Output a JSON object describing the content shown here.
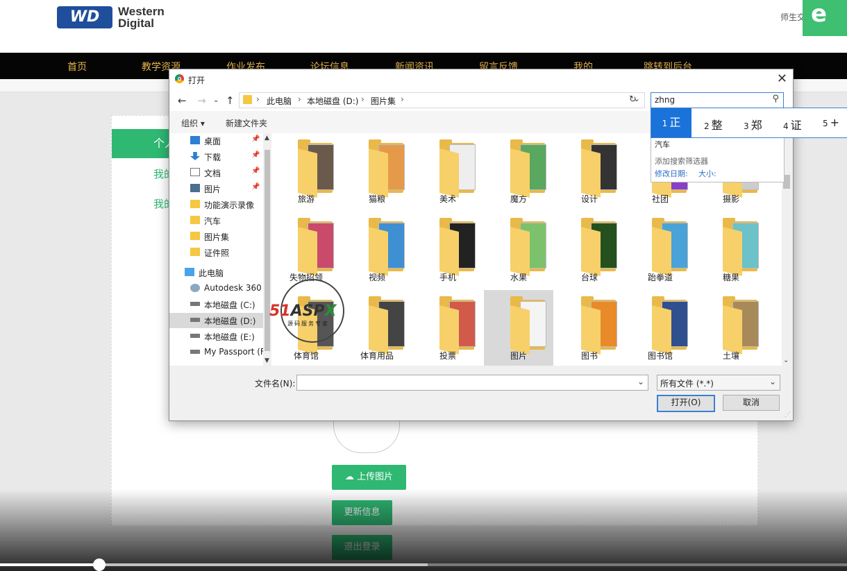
{
  "site": {
    "logo_badge": "WD",
    "logo_line1": "Western",
    "logo_line2": "Digital",
    "user_text": "师生交",
    "ie_badge": "e",
    "nav": [
      "首页",
      "教学资源",
      "作业发布",
      "论坛信息",
      "新闻资讯",
      "留言反馈",
      "我的",
      "跳转到后台"
    ],
    "left_menu_head": "个人",
    "left_links": [
      "我的",
      "我的"
    ],
    "upload_button": "上传图片",
    "update_button": "更新信息",
    "logout_button": "退出登录",
    "video_progress": 0.117,
    "video_buffered": 0.505
  },
  "dialog": {
    "title": "打开",
    "breadcrumb": [
      "此电脑",
      "本地磁盘 (D:)",
      "图片集"
    ],
    "search_value": "zhng",
    "toolbar": {
      "organize": "组织 ▾",
      "new_folder": "新建文件夹"
    },
    "sidebar": [
      {
        "label": "桌面",
        "icon": "desktop-icon",
        "pinned": true
      },
      {
        "label": "下载",
        "icon": "download-icon",
        "pinned": true
      },
      {
        "label": "文档",
        "icon": "document-icon",
        "pinned": true
      },
      {
        "label": "图片",
        "icon": "pictures-icon",
        "pinned": true
      },
      {
        "label": "功能演示录像",
        "icon": "folder-icon",
        "pinned": false
      },
      {
        "label": "汽车",
        "icon": "folder-icon",
        "pinned": false
      },
      {
        "label": "图片集",
        "icon": "folder-icon",
        "pinned": false
      },
      {
        "label": "证件照",
        "icon": "folder-icon",
        "pinned": false
      },
      {
        "label": "此电脑",
        "icon": "computer-icon",
        "pinned": false
      },
      {
        "label": "Autodesk 360",
        "icon": "cloud-icon",
        "pinned": false
      },
      {
        "label": "本地磁盘 (C:)",
        "icon": "drive-icon",
        "pinned": false
      },
      {
        "label": "本地磁盘 (D:)",
        "icon": "drive-icon",
        "pinned": false,
        "selected": true
      },
      {
        "label": "本地磁盘 (E:)",
        "icon": "drive-icon",
        "pinned": false
      },
      {
        "label": "My Passport (F",
        "icon": "drive-icon",
        "pinned": false
      }
    ],
    "folders": [
      [
        "旅游",
        "猫粮",
        "美术",
        "魔方",
        "设计",
        "社团",
        "摄影"
      ],
      [
        "失物招领",
        "视频",
        "手机",
        "水果",
        "台球",
        "跆拳道",
        "糖果"
      ],
      [
        "体育馆",
        "体育用品",
        "投票",
        "图片",
        "图书",
        "图书馆",
        "土壤"
      ]
    ],
    "selected_folder": "图片",
    "filename_label": "文件名(N):",
    "filename_value": "",
    "filetype_value": "所有文件 (*.*)",
    "open_button": "打开(O)",
    "cancel_button": "取消"
  },
  "suggest": {
    "item": "汽车",
    "add_filter": "添加搜索筛选器",
    "modified_date": "修改日期:",
    "size": "大小:"
  },
  "ime": {
    "candidates": [
      {
        "num": "1",
        "text": "正"
      },
      {
        "num": "2",
        "text": "整"
      },
      {
        "num": "3",
        "text": "郑"
      },
      {
        "num": "4",
        "text": "证"
      },
      {
        "num": "5",
        "text": "+"
      }
    ]
  },
  "watermark": {
    "brand": "51ASPX",
    "slogan": "源码服务专家"
  },
  "colors": {
    "accent_green": "#2eb872",
    "nav_gold": "#e8b64e",
    "selection_blue": "#1a73d9"
  }
}
